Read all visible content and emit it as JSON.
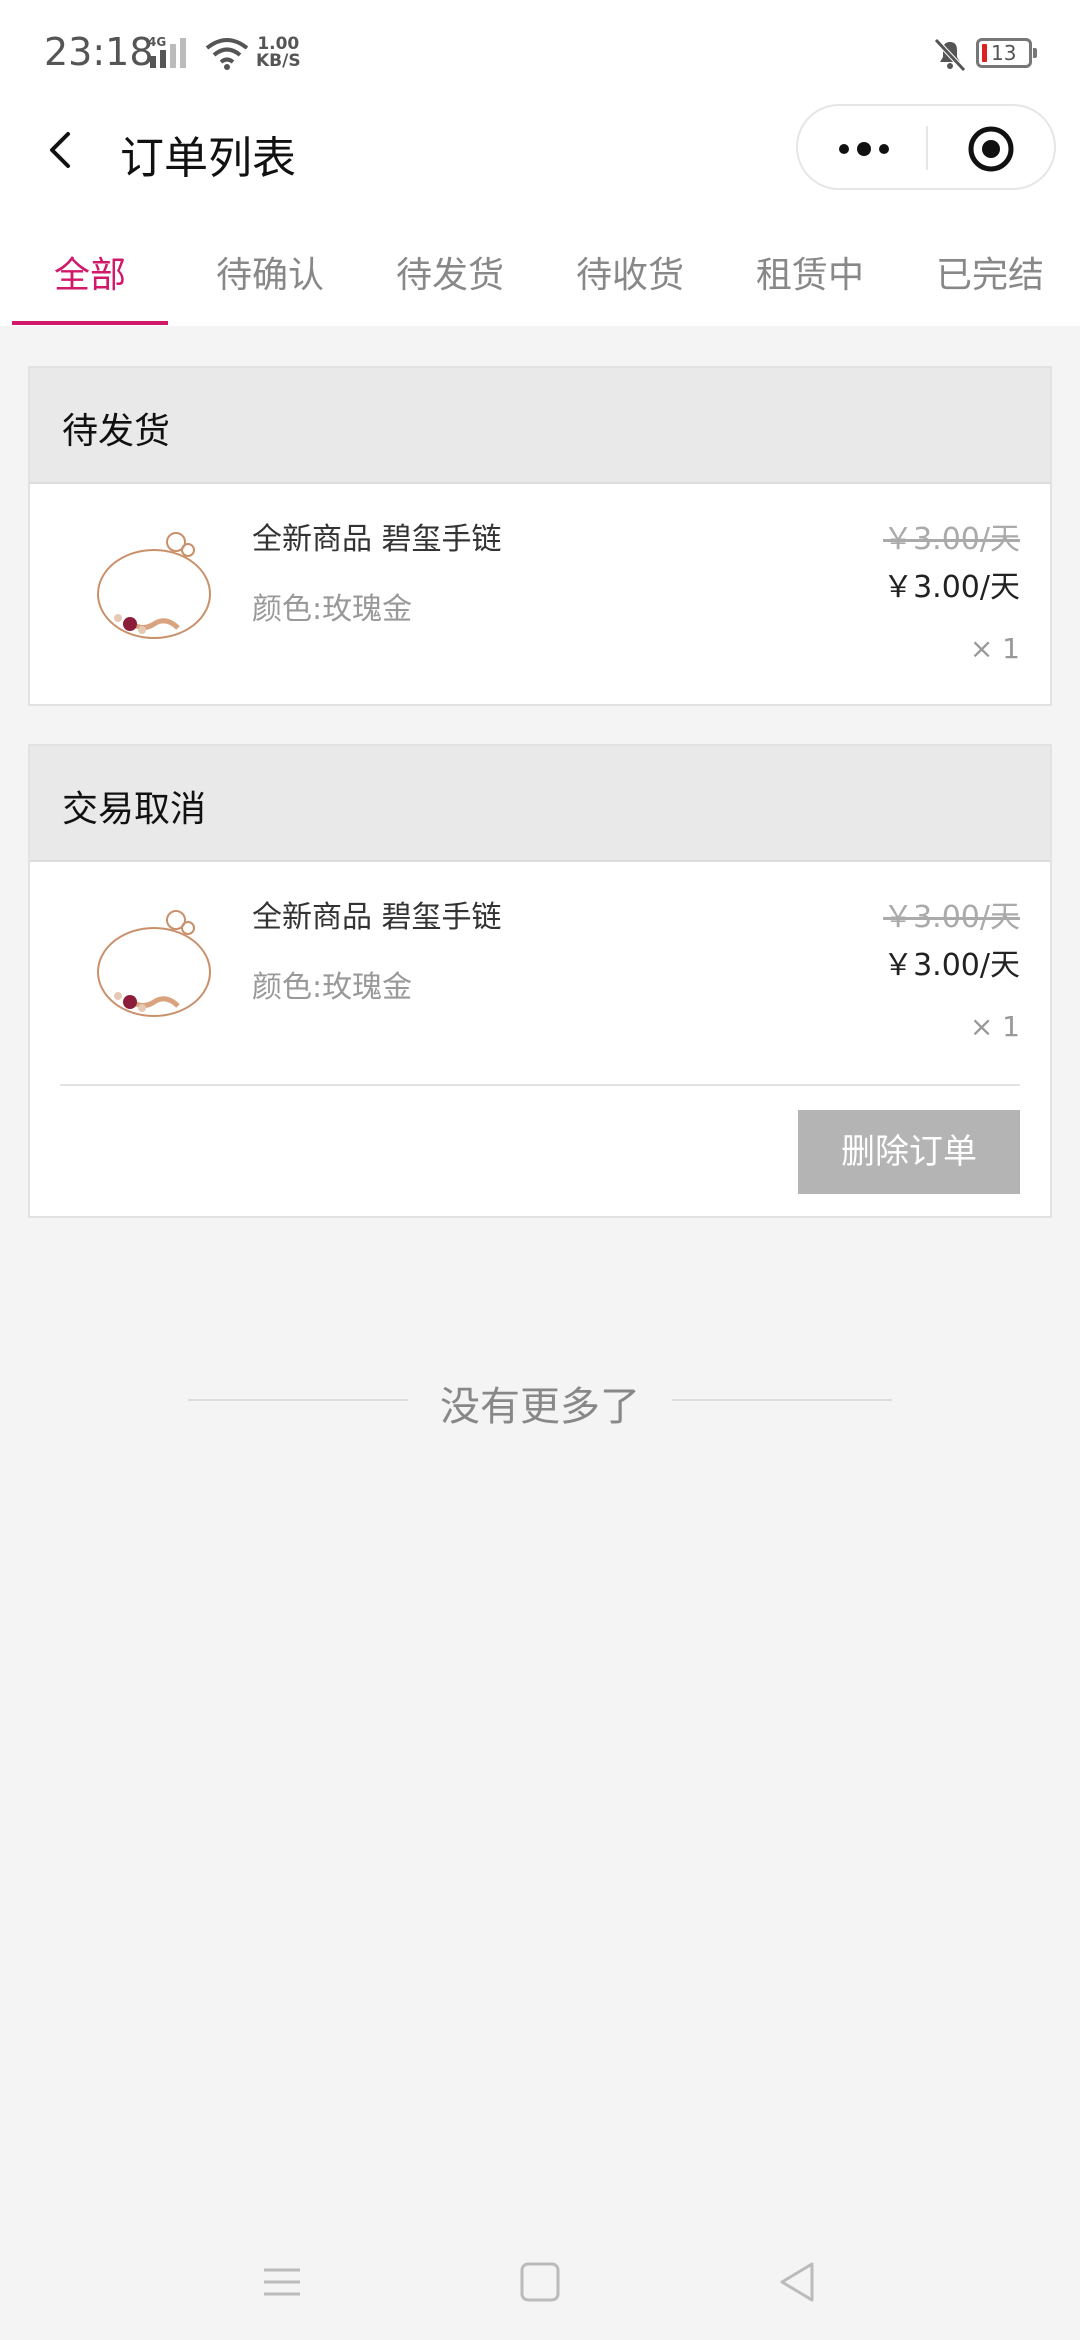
{
  "status_bar": {
    "time": "23:18",
    "network": "4G",
    "speed_value": "1.00",
    "speed_unit": "KB/S",
    "battery": "13"
  },
  "nav": {
    "title": "订单列表"
  },
  "tabs": [
    {
      "label": "全部",
      "active": true
    },
    {
      "label": "待确认"
    },
    {
      "label": "待发货"
    },
    {
      "label": "待收货"
    },
    {
      "label": "租赁中"
    },
    {
      "label": "已完结"
    }
  ],
  "orders": [
    {
      "status": "待发货",
      "item": {
        "name": "全新商品 碧玺手链",
        "attr": "颜色:玫瑰金",
        "price_old": "￥3.00/天",
        "price_now": "￥3.00/天",
        "qty": "× 1"
      }
    },
    {
      "status": "交易取消",
      "item": {
        "name": "全新商品 碧玺手链",
        "attr": "颜色:玫瑰金",
        "price_old": "￥3.00/天",
        "price_now": "￥3.00/天",
        "qty": "× 1"
      },
      "action_label": "删除订单"
    }
  ],
  "footer": {
    "no_more": "没有更多了"
  },
  "colors": {
    "accent": "#d1186a",
    "header_bg": "#e9e9e9",
    "button_bg": "#b4b4b4"
  }
}
